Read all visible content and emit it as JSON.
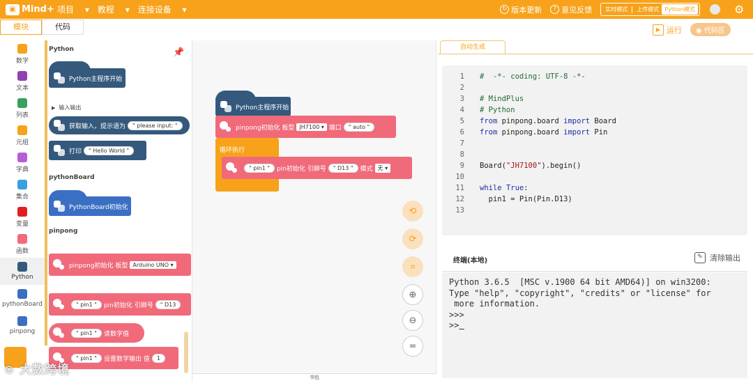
{
  "topbar": {
    "logo": "Mind+",
    "menus": [
      "项目",
      "教程",
      "连接设备"
    ],
    "update": "版本更新",
    "feedback": "意见反馈",
    "modes": [
      "实时模式",
      "上传模式",
      "Python模式"
    ],
    "active_mode": "Python模式"
  },
  "tabs": {
    "blocks": "模块",
    "code": "代码"
  },
  "actions": {
    "run": "运行",
    "code_area": "代码区"
  },
  "categories": [
    {
      "label": "数字",
      "color": "#f7a21a"
    },
    {
      "label": "文本",
      "color": "#8e44ad"
    },
    {
      "label": "列表",
      "color": "#3aa15c"
    },
    {
      "label": "元组",
      "color": "#f7a21a"
    },
    {
      "label": "字典",
      "color": "#b65fd5"
    },
    {
      "label": "集合",
      "color": "#3aa0e0"
    },
    {
      "label": "变量",
      "color": "#e02020"
    },
    {
      "label": "函数",
      "color": "#f06a7a"
    },
    {
      "label": "Python",
      "color": "#34597d"
    },
    {
      "label": "pythonBoard",
      "color": "#3a6fc4"
    },
    {
      "label": "pinpong",
      "color": "#3a6fc4"
    }
  ],
  "palette": {
    "section_python": "Python",
    "block_main": "Python主程序开始",
    "io_title": "输入输出",
    "input_block": {
      "label": "获取输入，提示语为",
      "value": "please input:"
    },
    "print_block": {
      "label": "打印",
      "value": "Hello World"
    },
    "section_pythonboard": "pythonBoard",
    "pythonboard_init": "PythonBoard初始化",
    "section_pinpong": "pinpong",
    "pinpong_init": {
      "label": "pinpong初始化 板型",
      "board": "Arduino UNO"
    },
    "pin_init": {
      "var": "pin1",
      "label": "pin初始化 引脚号",
      "pin": "D13"
    },
    "read_digital": {
      "var": "pin1",
      "label": "读数字值"
    },
    "set_digital": {
      "var": "pin1",
      "label": "设置数字输出 值",
      "value": "1"
    }
  },
  "workspace": {
    "main_block": "Python主程序开始",
    "pinpong_init": {
      "label": "pinpong初始化 板型",
      "board": "JH7100",
      "port_label": "端口",
      "port": "auto"
    },
    "loop": "循环执行",
    "pin_init": {
      "var": "pin1",
      "label": "pin初始化 引脚号",
      "pin": "D13",
      "mode_label": "模式",
      "mode": "无"
    },
    "footer": "书包"
  },
  "code_panel": {
    "tab": "自动生成",
    "lines": [
      {
        "n": "1",
        "text": "#  -*- coding: UTF-8 -*-"
      },
      {
        "n": "2",
        "text": ""
      },
      {
        "n": "3",
        "text": "# MindPlus"
      },
      {
        "n": "4",
        "text": "# Python"
      },
      {
        "n": "5",
        "text": "from pinpong.board import Board"
      },
      {
        "n": "6",
        "text": "from pinpong.board import Pin"
      },
      {
        "n": "7",
        "text": ""
      },
      {
        "n": "8",
        "text": ""
      },
      {
        "n": "9",
        "text": "Board(\"JH7100\").begin()"
      },
      {
        "n": "10",
        "text": ""
      },
      {
        "n": "11",
        "text": "while True:"
      },
      {
        "n": "12",
        "text": "  pin1 = Pin(Pin.D13)"
      },
      {
        "n": "13",
        "text": ""
      }
    ]
  },
  "terminal": {
    "title": "终端(本地)",
    "clear": "清除输出",
    "lines": [
      "Python 3.6.5  [MSC v.1900 64 bit AMD64)] on win3200:",
      "Type \"help\", \"copyright\", \"credits\" or \"license\" for",
      " more information.",
      ">>>"
    ],
    "prompt": ">>"
  },
  "watermark": "大数跨境"
}
